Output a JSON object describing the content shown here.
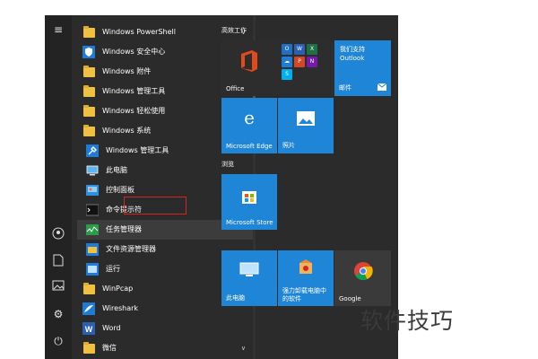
{
  "apps": [
    {
      "label": "Windows PowerShell",
      "icon": "folder",
      "chevron": "∨"
    },
    {
      "label": "Windows 安全中心",
      "icon": "shield"
    },
    {
      "label": "Windows 附件",
      "icon": "folder",
      "chevron": "∨"
    },
    {
      "label": "Windows 管理工具",
      "icon": "folder",
      "chevron": "∨"
    },
    {
      "label": "Windows 轻松使用",
      "icon": "folder",
      "chevron": "∨"
    },
    {
      "label": "Windows 系统",
      "icon": "folder",
      "chevron": "∧"
    },
    {
      "label": "Windows 管理工具",
      "icon": "admin-tools"
    },
    {
      "label": "此电脑",
      "icon": "this-pc"
    },
    {
      "label": "控制面板",
      "icon": "control-panel"
    },
    {
      "label": "命令提示符",
      "icon": "cmd"
    },
    {
      "label": "任务管理器",
      "icon": "task-manager"
    },
    {
      "label": "文件资源管理器",
      "icon": "file-explorer"
    },
    {
      "label": "运行",
      "icon": "run"
    },
    {
      "label": "WinPcap",
      "icon": "folder",
      "chevron": "∨"
    },
    {
      "label": "Wireshark",
      "icon": "wireshark"
    },
    {
      "label": "Word",
      "icon": "word"
    },
    {
      "label": "微信",
      "icon": "folder",
      "chevron": "∨"
    }
  ],
  "groups": {
    "productivity": "高效工作",
    "browse": "浏览"
  },
  "tiles": {
    "office": "Office",
    "outlook_title": "我们支持",
    "outlook_sub": "Outlook",
    "mail": "邮件",
    "edge": "Microsoft Edge",
    "photos": "照片",
    "store": "Microsoft Store",
    "this_pc": "此电脑",
    "uninstall": "强力卸载电脑中的软件",
    "chrome": "Google"
  },
  "watermark": "软件技巧",
  "colors": {
    "tile_blue": "#1f85d6",
    "menu_bg": "#2b2b2b",
    "highlight_box": "#d2261f"
  }
}
